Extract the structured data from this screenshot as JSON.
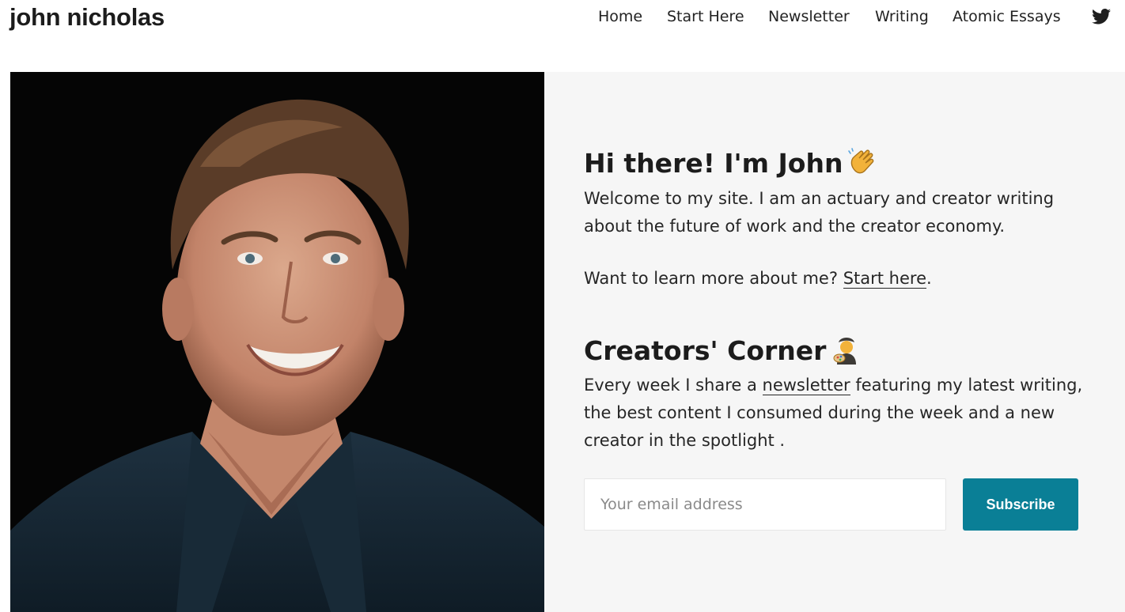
{
  "site": {
    "title": "john nicholas"
  },
  "nav": {
    "items": [
      {
        "label": "Home"
      },
      {
        "label": "Start Here"
      },
      {
        "label": "Newsletter"
      },
      {
        "label": "Writing"
      },
      {
        "label": "Atomic Essays"
      }
    ],
    "social_icon": "twitter-icon"
  },
  "hero": {
    "photo_alt": "Portrait of John Nicholas",
    "intro": {
      "heading": "Hi there! I'm John",
      "heading_emoji": "waving-hand-icon",
      "paragraph": "Welcome to my site. I am an actuary and creator writing about the future of work and the creator economy.",
      "learn_more_prefix": "Want to learn more about me?",
      "learn_more_link": "Start here",
      "learn_more_suffix": "."
    },
    "newsletter": {
      "heading": "Creators' Corner",
      "heading_emoji": "artist-icon",
      "text_prefix": "Every week I share a",
      "text_link": "newsletter",
      "text_suffix": "featuring my latest writing, the best content I consumed during the week and a new creator in the spotlight .",
      "email_placeholder": "Your email address",
      "email_value": "",
      "subscribe_label": "Subscribe"
    }
  },
  "colors": {
    "accent": "#0a7f96",
    "panel_bg": "#f6f6f6",
    "photo_bg": "#050505",
    "text": "#1f1f1f"
  }
}
